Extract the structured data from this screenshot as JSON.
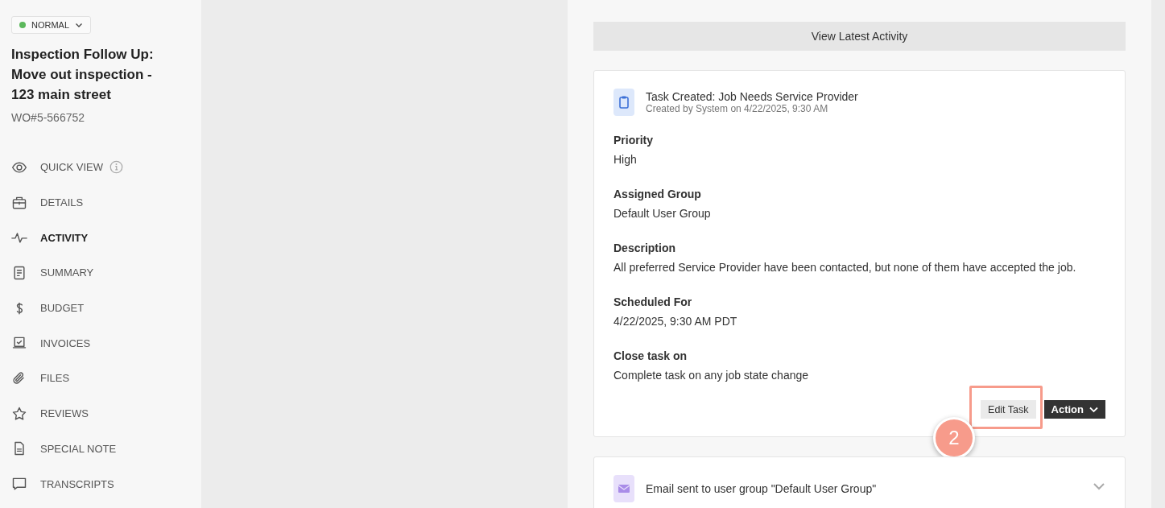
{
  "sidebar": {
    "status": {
      "label": "NORMAL",
      "color": "#5cb85c"
    },
    "title": "Inspection Follow Up: Move out inspection - 123 main street",
    "work_order": "WO#5-566752",
    "items": [
      {
        "label": "QUICK VIEW",
        "info": true,
        "selected": false
      },
      {
        "label": "DETAILS",
        "info": false,
        "selected": false
      },
      {
        "label": "ACTIVITY",
        "info": false,
        "selected": true
      },
      {
        "label": "SUMMARY",
        "info": false,
        "selected": false
      },
      {
        "label": "BUDGET",
        "info": false,
        "selected": false
      },
      {
        "label": "INVOICES",
        "info": false,
        "selected": false
      },
      {
        "label": "FILES",
        "info": false,
        "selected": false
      },
      {
        "label": "REVIEWS",
        "info": false,
        "selected": false
      },
      {
        "label": "SPECIAL NOTE",
        "info": false,
        "selected": false
      },
      {
        "label": "TRANSCRIPTS",
        "info": false,
        "selected": false
      }
    ]
  },
  "main": {
    "latest_button": "View Latest Activity",
    "cards": [
      {
        "kind": "task",
        "title": "Task Created: Job Needs Service Provider",
        "subtitle": "Created by System on 4/22/2025, 9:30 AM",
        "fields": [
          {
            "label": "Priority",
            "value": "High"
          },
          {
            "label": "Assigned Group",
            "value": "Default User Group"
          },
          {
            "label": "Description",
            "value": "All preferred Service Provider have been contacted, but none of them have accepted the job."
          },
          {
            "label": "Scheduled For",
            "value": "4/22/2025, 9:30 AM PDT"
          },
          {
            "label": "Close task on",
            "value": "Complete task on any job state change"
          }
        ],
        "edit_button": "Edit Task",
        "action_button": "Action",
        "annotation": "2"
      },
      {
        "kind": "email",
        "title": "Email sent to user group \"Default User Group\""
      }
    ]
  }
}
